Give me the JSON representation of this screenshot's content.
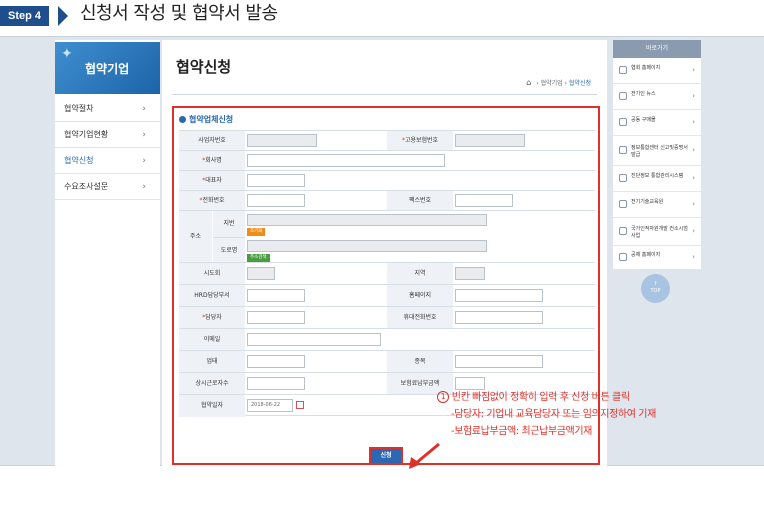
{
  "step": {
    "badge": "Step 4",
    "title": "신청서 작성 및 협약서 발송"
  },
  "sidebar": {
    "banner": "협약기업",
    "items": [
      {
        "label": "협약절차",
        "active": false
      },
      {
        "label": "협약기업현황",
        "active": false
      },
      {
        "label": "협약신청",
        "active": true
      },
      {
        "label": "수요조사설문",
        "active": false
      }
    ]
  },
  "page": {
    "title": "협약신청",
    "breadcrumb": {
      "home": "⌂",
      "path1": "협약기업",
      "current": "협약신청"
    }
  },
  "form": {
    "section_title": "협약업체신청",
    "labels": {
      "biz_no": "사업자번호",
      "insurance_no": "고용보험번호",
      "company": "회사명",
      "ceo": "대표자",
      "phone": "전화번호",
      "fax": "팩스번호",
      "address": "주소",
      "lot": "지번",
      "road": "도로명",
      "city": "시도회",
      "region": "지역",
      "hrd": "HRD담당부서",
      "homepage": "홈페이지",
      "manager": "담당자",
      "mobile": "휴대전화번호",
      "email": "이메일",
      "industry": "업태",
      "item": "종목",
      "workers": "상시근로자수",
      "premium": "보험료납부금액",
      "agree_date": "협약일자"
    },
    "values": {
      "biz_no": "",
      "insurance_no": "",
      "company": "",
      "ceo": "",
      "phone": "",
      "fax": "",
      "lot": "",
      "road": "",
      "city": "",
      "region": "",
      "agree_date": "2018-06-22"
    },
    "buttons": {
      "lot": "조기화",
      "road": "주소검색",
      "submit": "신청"
    }
  },
  "quick_menu": {
    "title": "바로가기",
    "items": [
      {
        "icon": "home-icon",
        "label": "협회 홈페이지"
      },
      {
        "icon": "news-icon",
        "label": "전기인 뉴스"
      },
      {
        "icon": "cart-icon",
        "label": "공동 구매몰"
      },
      {
        "icon": "document-icon",
        "label": "정보통합센터 신고및증명서발급"
      },
      {
        "icon": "monitor-icon",
        "label": "진단정보 통합관리시스템"
      },
      {
        "icon": "book-icon",
        "label": "전기기술교육원"
      },
      {
        "icon": "people-icon",
        "label": "국가인적자원개발 컨소시엄사업"
      },
      {
        "icon": "building-icon",
        "label": "공제 홈페이지"
      }
    ],
    "top": "TOP"
  },
  "annotation": {
    "number": "1",
    "line1": "빈칸 빠짐없이 정확히 입력 후 신청 버튼 클릭",
    "line2": "-담당자: 기업내 교육담당자 또는 임의지정하여 기재",
    "line3": "-보험료납부금액: 최근납부금액기재"
  },
  "colors": {
    "accent": "#2b68b1",
    "highlight": "#e0302a",
    "step_badge": "#1f4e8c"
  }
}
